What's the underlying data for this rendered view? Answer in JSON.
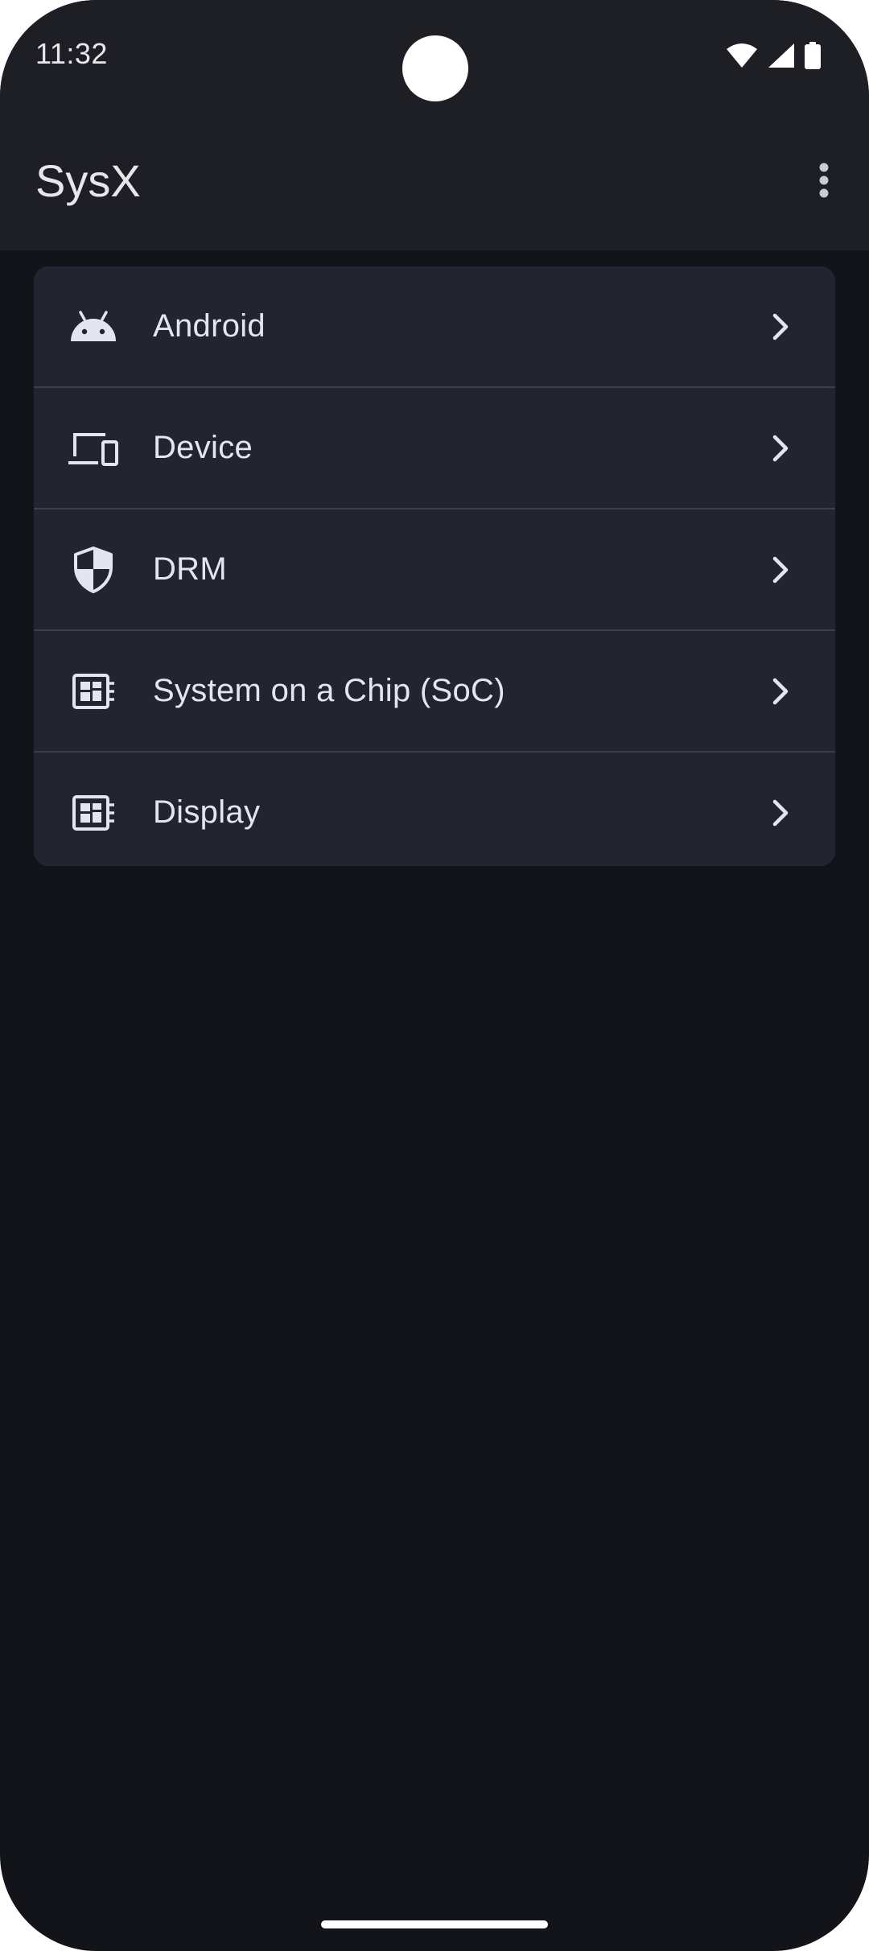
{
  "status_bar": {
    "time": "11:32",
    "icons": [
      "wifi-icon",
      "cellular-signal-icon",
      "battery-icon"
    ]
  },
  "app_bar": {
    "title": "SysX",
    "overflow_icon": "more-vert-icon"
  },
  "menu": {
    "items": [
      {
        "label": "Android",
        "icon": "android-icon"
      },
      {
        "label": "Device",
        "icon": "devices-icon"
      },
      {
        "label": "DRM",
        "icon": "shield-icon"
      },
      {
        "label": "System on a Chip (SoC)",
        "icon": "chip-icon"
      },
      {
        "label": "Display",
        "icon": "chip-icon"
      }
    ]
  },
  "colors": {
    "background": "#131419",
    "app_bar": "#1e1f24",
    "card": "#22242f",
    "divider": "#3b3e4b",
    "text": "#e4e5ee"
  }
}
